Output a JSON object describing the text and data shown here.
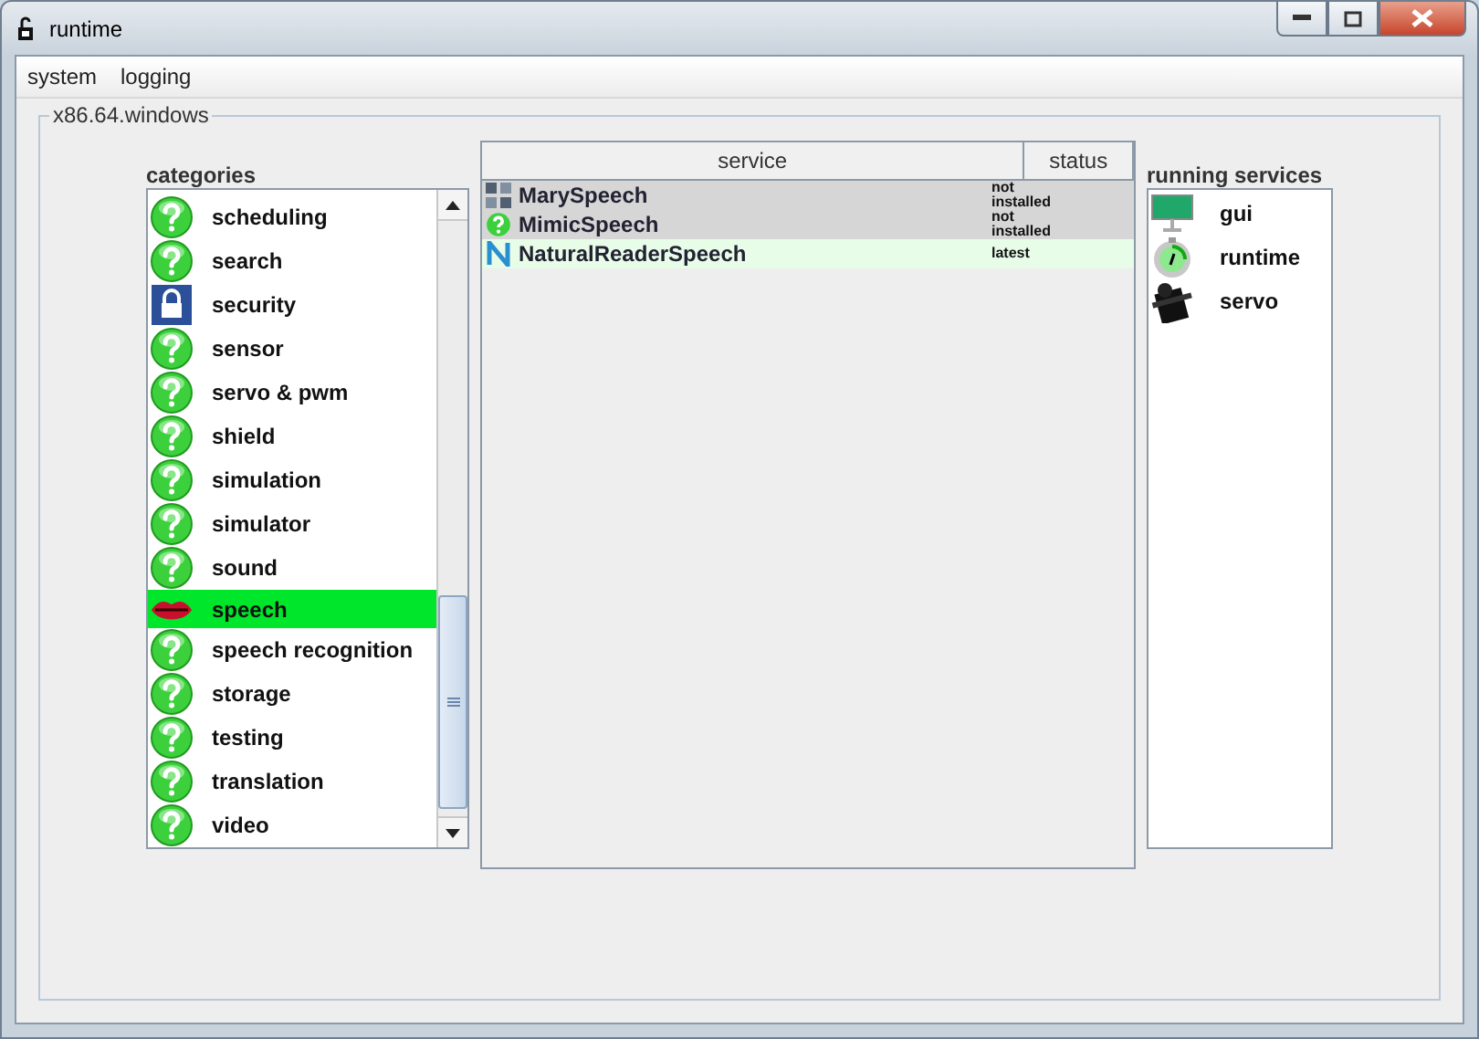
{
  "window": {
    "title": "runtime"
  },
  "menu": [
    "system",
    "logging"
  ],
  "group": {
    "title": "x86.64.windows"
  },
  "categories": {
    "label": "categories",
    "items": [
      {
        "label": "scheduling",
        "kind": "question",
        "selected": false
      },
      {
        "label": "search",
        "kind": "question",
        "selected": false
      },
      {
        "label": "security",
        "kind": "lock",
        "selected": false
      },
      {
        "label": "sensor",
        "kind": "question",
        "selected": false
      },
      {
        "label": "servo & pwm",
        "kind": "question",
        "selected": false
      },
      {
        "label": "shield",
        "kind": "question",
        "selected": false
      },
      {
        "label": "simulation",
        "kind": "question",
        "selected": false
      },
      {
        "label": "simulator",
        "kind": "question",
        "selected": false
      },
      {
        "label": "sound",
        "kind": "question",
        "selected": false
      },
      {
        "label": "speech",
        "kind": "lips",
        "selected": true
      },
      {
        "label": "speech recognition",
        "kind": "question",
        "selected": false
      },
      {
        "label": "storage",
        "kind": "question",
        "selected": false
      },
      {
        "label": "testing",
        "kind": "question",
        "selected": false
      },
      {
        "label": "translation",
        "kind": "question",
        "selected": false
      },
      {
        "label": "video",
        "kind": "question",
        "selected": false
      }
    ]
  },
  "services": {
    "columns": [
      "service",
      "status"
    ],
    "rows": [
      {
        "name": "MarySpeech",
        "kind": "grid",
        "status": "not installed",
        "installed": false
      },
      {
        "name": "MimicSpeech",
        "kind": "question",
        "status": "not installed",
        "installed": false
      },
      {
        "name": "NaturalReaderSpeech",
        "kind": "letter",
        "status": "latest",
        "installed": true
      }
    ]
  },
  "running": {
    "label": "running services",
    "items": [
      {
        "name": "gui",
        "kind": "gui"
      },
      {
        "name": "runtime",
        "kind": "runtime"
      },
      {
        "name": "servo",
        "kind": "servo"
      }
    ]
  }
}
